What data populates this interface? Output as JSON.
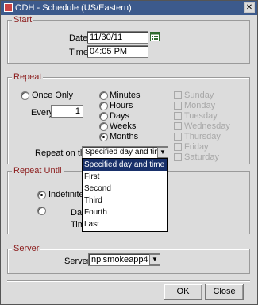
{
  "window": {
    "title": "ODH - Schedule (US/Eastern)"
  },
  "start": {
    "title": "Start",
    "date_label": "Date",
    "date_value": "11/30/11",
    "time_label": "Time",
    "time_value": "04:05 PM"
  },
  "repeat": {
    "title": "Repeat",
    "once_only": "Once Only",
    "every_label": "Every",
    "every_value": "1",
    "units": [
      "Minutes",
      "Hours",
      "Days",
      "Weeks",
      "Months"
    ],
    "selected_unit": "Months",
    "days": [
      "Sunday",
      "Monday",
      "Tuesday",
      "Wednesday",
      "Thursday",
      "Friday",
      "Saturday"
    ],
    "repeat_on_label": "Repeat on the",
    "repeat_on_value": "Specified day and time",
    "options": [
      "Specified day and time",
      "First",
      "Second",
      "Third",
      "Fourth",
      "Last"
    ]
  },
  "repeat_until": {
    "title": "Repeat Until",
    "indefinite": "Indefinite",
    "date_label_partial": "Da",
    "time_label_partial": "Tim"
  },
  "server": {
    "title": "Server",
    "label": "Server",
    "value": "nplsmokeapp4"
  },
  "buttons": {
    "ok": "OK",
    "close": "Close"
  }
}
